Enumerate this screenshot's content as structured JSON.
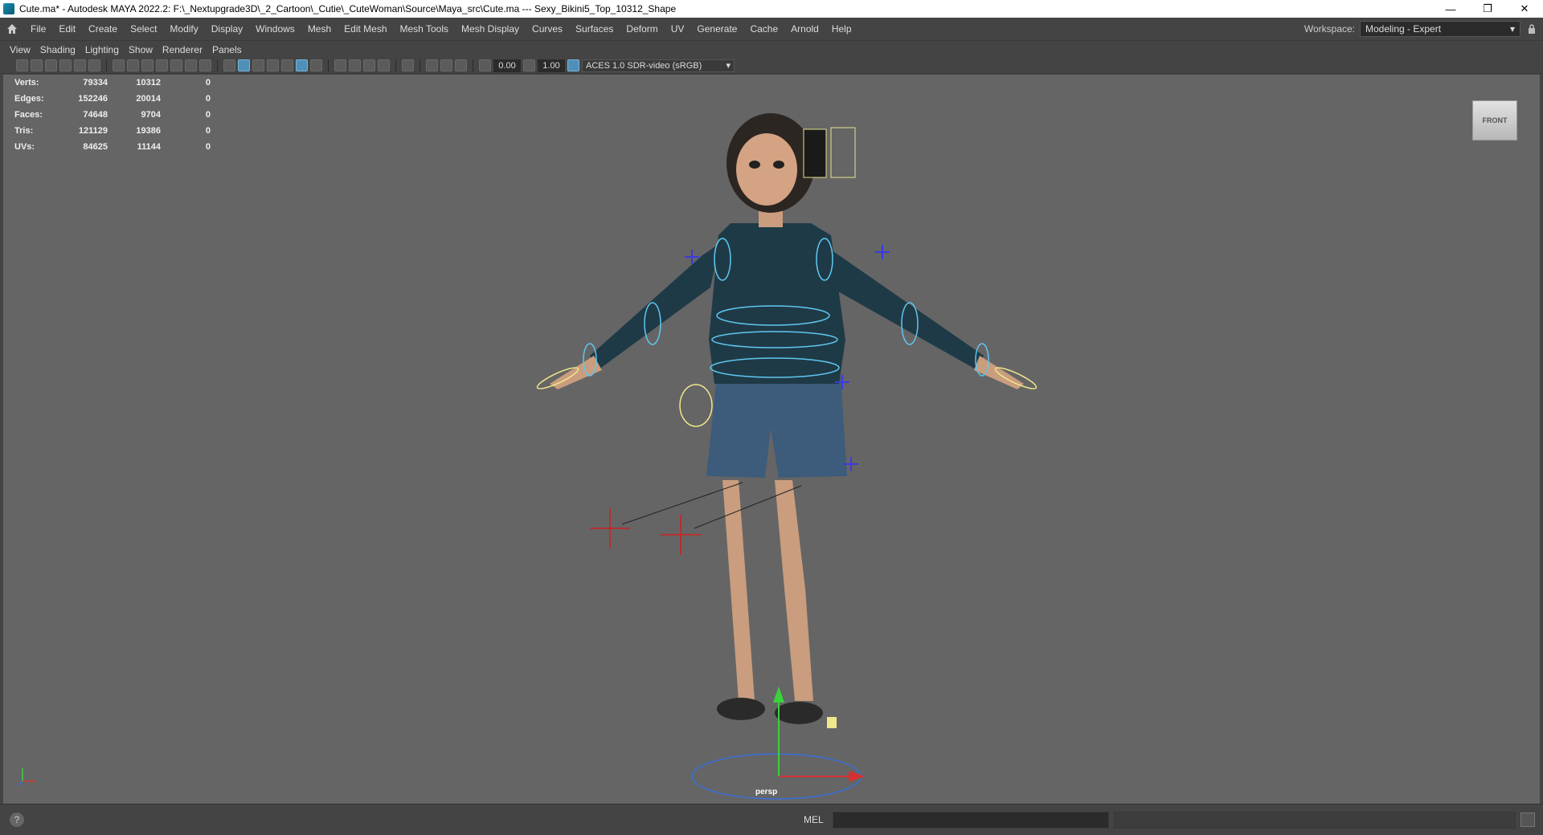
{
  "window": {
    "title": "Cute.ma* - Autodesk MAYA 2022.2: F:\\_Nextupgrade3D\\_2_Cartoon\\_Cutie\\_CuteWoman\\Source\\Maya_src\\Cute.ma   ---   Sexy_Bikini5_Top_10312_Shape",
    "minimize": "—",
    "restore": "❐",
    "close": "✕"
  },
  "menubar": {
    "items": [
      "File",
      "Edit",
      "Create",
      "Select",
      "Modify",
      "Display",
      "Windows",
      "Mesh",
      "Edit Mesh",
      "Mesh Tools",
      "Mesh Display",
      "Curves",
      "Surfaces",
      "Deform",
      "UV",
      "Generate",
      "Cache",
      "Arnold",
      "Help"
    ],
    "workspace_label": "Workspace:",
    "workspace_value": "Modeling - Expert"
  },
  "panel_menu": {
    "items": [
      "View",
      "Shading",
      "Lighting",
      "Show",
      "Renderer",
      "Panels"
    ]
  },
  "toolbar": {
    "exposure": "0.00",
    "gamma": "1.00",
    "color_space": "ACES 1.0 SDR-video (sRGB)"
  },
  "hud": {
    "rows": [
      {
        "label": "Verts:",
        "total": "79334",
        "selected": "10312",
        "extra": "0"
      },
      {
        "label": "Edges:",
        "total": "152246",
        "selected": "20014",
        "extra": "0"
      },
      {
        "label": "Faces:",
        "total": "74648",
        "selected": "9704",
        "extra": "0"
      },
      {
        "label": "Tris:",
        "total": "121129",
        "selected": "19386",
        "extra": "0"
      },
      {
        "label": "UVs:",
        "total": "84625",
        "selected": "11144",
        "extra": "0"
      }
    ]
  },
  "viewcube": {
    "face": "FRONT"
  },
  "camera": {
    "name": "persp"
  },
  "statusbar": {
    "help": "?",
    "mel": "MEL"
  },
  "colors": {
    "viewport_bg": "#656565",
    "ui_bg": "#444444",
    "control_curve": "#5ec8f0",
    "selected_curve": "#f0e68c",
    "ik_locator": "#d02020"
  }
}
